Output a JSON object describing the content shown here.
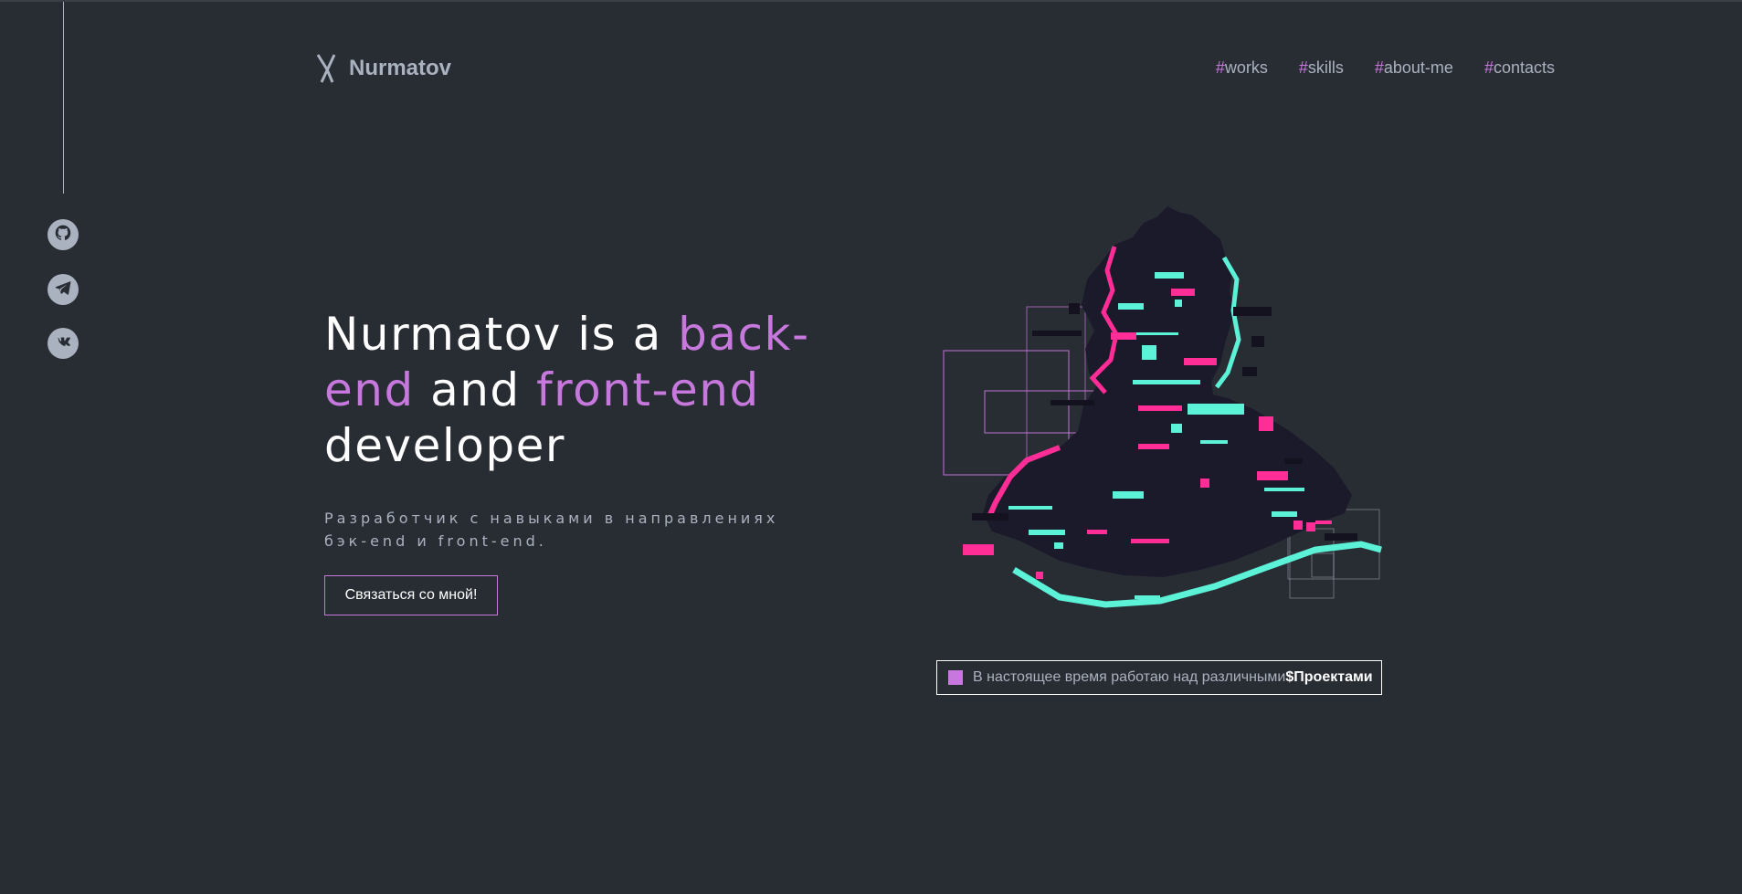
{
  "header": {
    "logo_text": "Nurmatov",
    "nav": [
      {
        "hash": "#",
        "label": "works"
      },
      {
        "hash": "#",
        "label": "skills"
      },
      {
        "hash": "#",
        "label": "about-me"
      },
      {
        "hash": "#",
        "label": "contacts"
      }
    ]
  },
  "social": [
    {
      "icon": "github-icon"
    },
    {
      "icon": "telegram-icon"
    },
    {
      "icon": "vk-icon"
    }
  ],
  "hero": {
    "headline_1": "Nurmatov is a ",
    "headline_accent_1": "back-end",
    "headline_2": " and ",
    "headline_accent_2": "front-end",
    "headline_3": " developer",
    "subtitle": "Разработчик с навыками в направлениях бэк-end и front-end.",
    "cta_label": "Связаться со мной!"
  },
  "status": {
    "text": "В настоящее время работаю над различными",
    "highlight": "$Проектами"
  },
  "colors": {
    "background": "#282c33",
    "accent": "#c778dd",
    "muted": "#abb2bf",
    "glitch_pink": "#ff2d95",
    "glitch_cyan": "#5cf2d8"
  }
}
